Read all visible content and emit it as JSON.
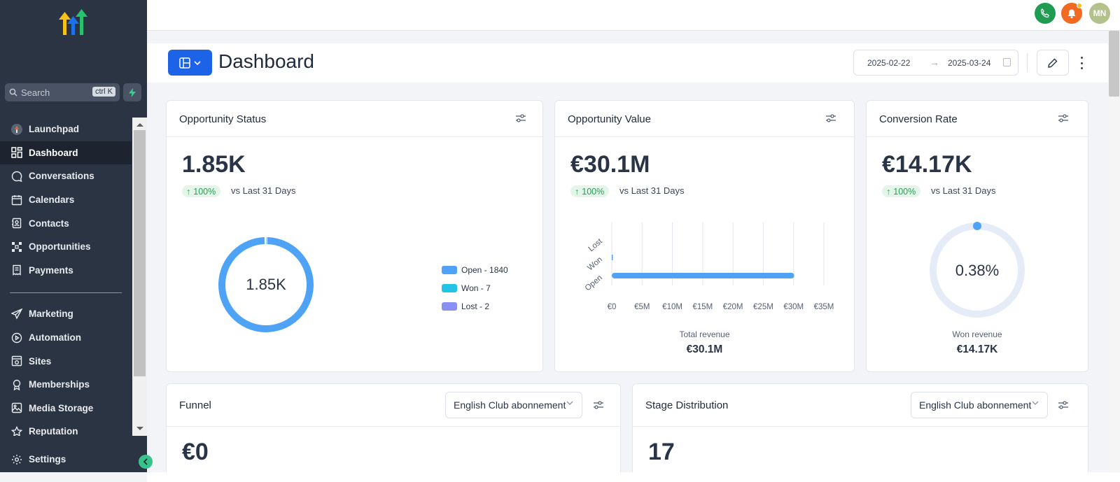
{
  "sidebar": {
    "search_placeholder": "Search",
    "search_shortcut": "ctrl K",
    "items_top": [
      {
        "label": "Launchpad",
        "icon": "launchpad-icon"
      },
      {
        "label": "Dashboard",
        "icon": "dashboard-icon",
        "active": true
      },
      {
        "label": "Conversations",
        "icon": "chat-icon"
      },
      {
        "label": "Calendars",
        "icon": "calendar-icon"
      },
      {
        "label": "Contacts",
        "icon": "contacts-icon"
      },
      {
        "label": "Opportunities",
        "icon": "opportunities-icon"
      },
      {
        "label": "Payments",
        "icon": "payments-icon"
      }
    ],
    "items_bottom": [
      {
        "label": "Marketing",
        "icon": "send-icon"
      },
      {
        "label": "Automation",
        "icon": "automation-icon"
      },
      {
        "label": "Sites",
        "icon": "sites-icon"
      },
      {
        "label": "Memberships",
        "icon": "memberships-icon"
      },
      {
        "label": "Media Storage",
        "icon": "image-icon"
      },
      {
        "label": "Reputation",
        "icon": "star-icon"
      }
    ],
    "settings_label": "Settings"
  },
  "topbar": {
    "avatar_initials": "MN"
  },
  "header": {
    "title": "Dashboard",
    "date_start": "2025-02-22",
    "date_end": "2025-03-24"
  },
  "cards": {
    "opportunity_status": {
      "title": "Opportunity Status",
      "value": "1.85K",
      "change": "100%",
      "compare": "vs Last 31 Days",
      "donut_center": "1.85K",
      "legend": [
        {
          "label": "Open - 1840",
          "color": "#4fa3f7"
        },
        {
          "label": "Won - 7",
          "color": "#22c3e6"
        },
        {
          "label": "Lost - 2",
          "color": "#8a8ff2"
        }
      ]
    },
    "opportunity_value": {
      "title": "Opportunity Value",
      "value": "€30.1M",
      "change": "100%",
      "compare": "vs Last 31 Days",
      "footer_label": "Total revenue",
      "footer_value": "€30.1M"
    },
    "conversion_rate": {
      "title": "Conversion Rate",
      "value": "€14.17K",
      "change": "100%",
      "compare": "vs Last 31 Days",
      "gauge_center": "0.38%",
      "footer_label": "Won revenue",
      "footer_value": "€14.17K"
    },
    "funnel": {
      "title": "Funnel",
      "select": "English Club abonnement",
      "value": "€0"
    },
    "stage_distribution": {
      "title": "Stage Distribution",
      "select": "English Club abonnement",
      "value": "17"
    }
  },
  "chart_data": [
    {
      "type": "pie",
      "categories": [
        "Open",
        "Won",
        "Lost"
      ],
      "values": [
        1840,
        7,
        2
      ],
      "colors": [
        "#4fa3f7",
        "#22c3e6",
        "#8a8ff2"
      ]
    },
    {
      "type": "bar",
      "orientation": "horizontal",
      "categories": [
        "Open",
        "Won",
        "Lost"
      ],
      "values": [
        30100000,
        14170,
        0
      ],
      "xlim": [
        0,
        35000000
      ],
      "x_tick_labels": [
        "€0",
        "€5M",
        "€10M",
        "€15M",
        "€20M",
        "€25M",
        "€30M",
        "€35M"
      ],
      "xlabel": "Total revenue",
      "grid": true,
      "color": "#4fa3f7"
    }
  ]
}
